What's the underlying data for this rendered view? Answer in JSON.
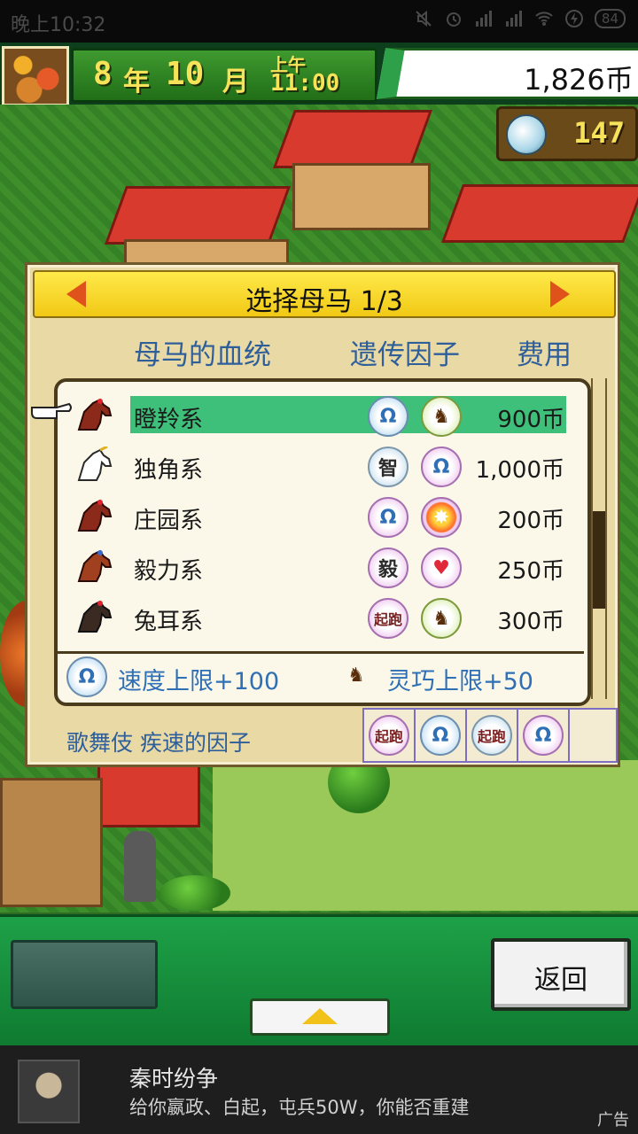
{
  "status_bar": {
    "time": "晚上10:32",
    "battery": "84"
  },
  "header": {
    "year": "8",
    "year_unit": "年",
    "month": "10",
    "month_unit": "月",
    "ampm": "上午",
    "clock": "11:00",
    "money": "1,826币",
    "medals": "147"
  },
  "dialog": {
    "title": "选择母马 1/3",
    "col_bloodline": "母马的血统",
    "col_factor": "遗传因子",
    "col_cost": "费用",
    "rows": [
      {
        "name": "瞪羚系",
        "factor1": "speed",
        "factor2": "agility",
        "cost": "900币",
        "selected": true
      },
      {
        "name": "独角系",
        "factor1_label": "智",
        "factor2": "speed",
        "cost": "1,000币"
      },
      {
        "name": "庄园系",
        "factor1": "speed",
        "factor2": "burst",
        "cost": "200币"
      },
      {
        "name": "毅力系",
        "factor1_label": "毅",
        "factor2": "heart",
        "cost": "250币"
      },
      {
        "name": "兔耳系",
        "factor1_label": "起跑",
        "factor2": "agility",
        "cost": "300币"
      }
    ],
    "detail_left": "速度上限+100",
    "detail_right": "灵巧上限+50",
    "bottom_text": "歌舞伎 疾速的因子",
    "strip_labels": [
      "起跑",
      "起跑"
    ]
  },
  "bottom": {
    "back_label": "返回"
  },
  "ad": {
    "title": "秦时纷争",
    "desc": "给你嬴政、白起，屯兵50W，你能否重建",
    "tag": "广告"
  },
  "colors": {
    "selected_row": "#3ec07a",
    "title_bar": "#f1c915",
    "accent_text": "#2f6fb5"
  }
}
